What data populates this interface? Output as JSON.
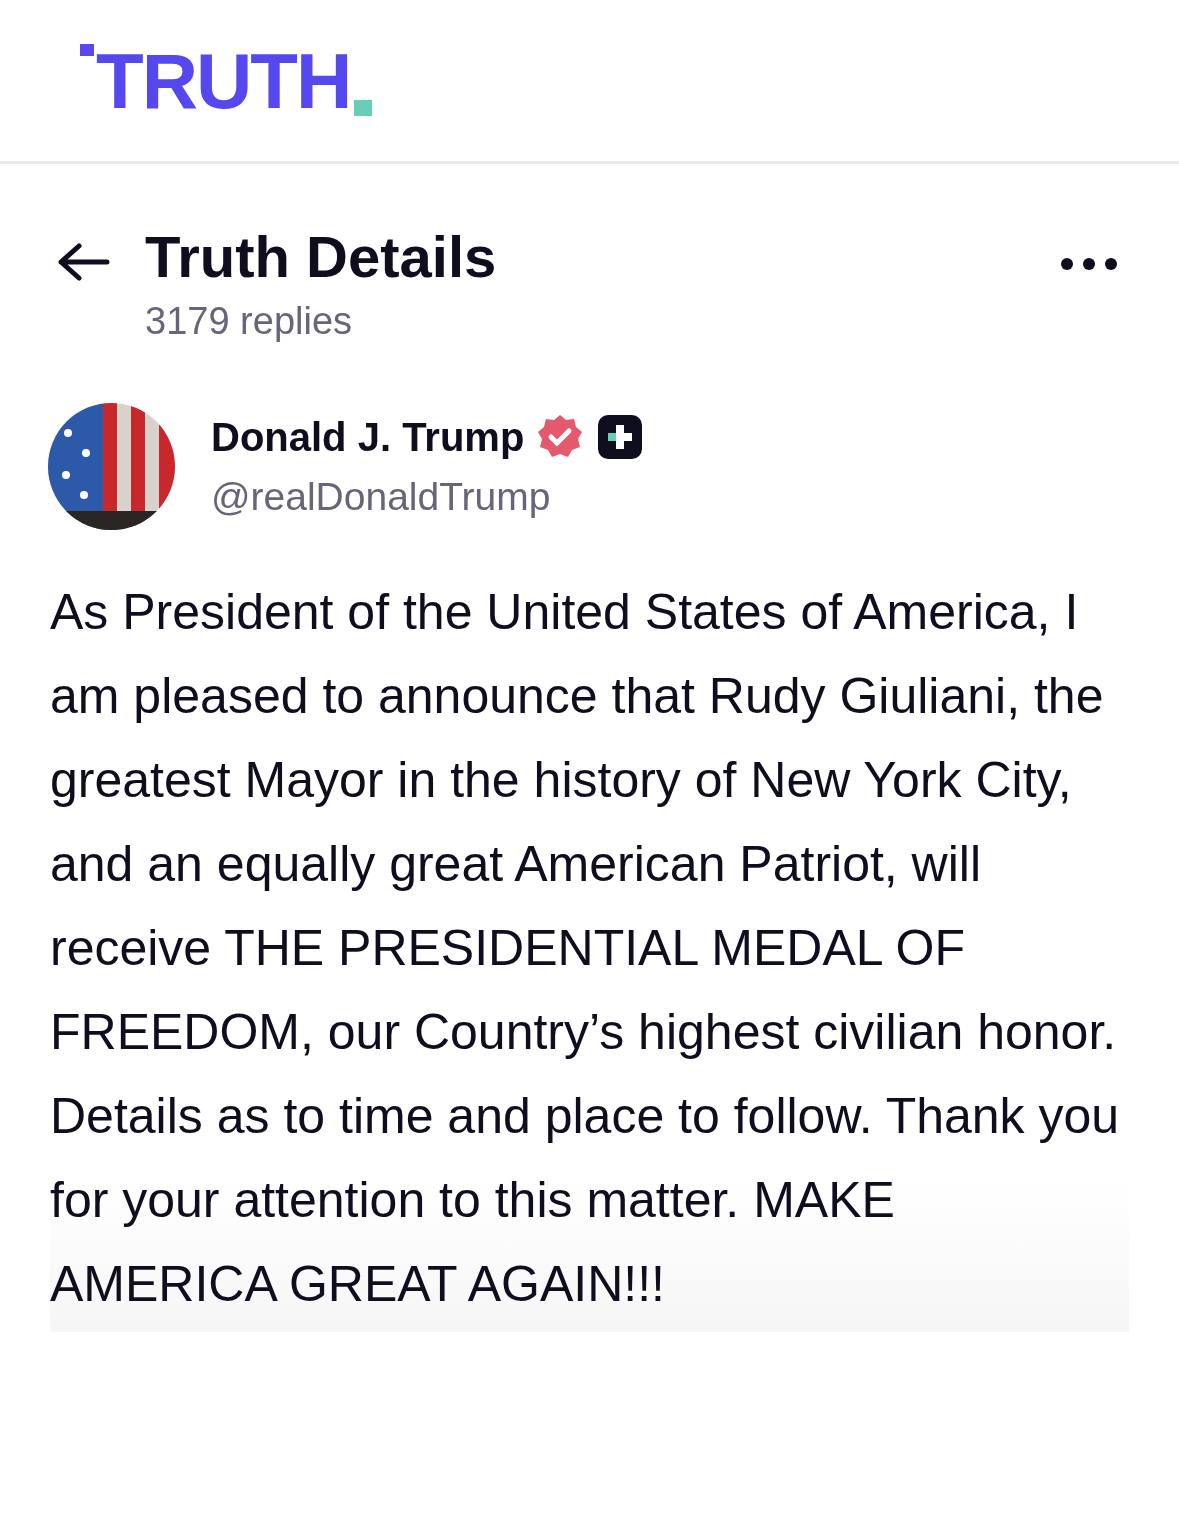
{
  "logo": {
    "text": "TRUTH"
  },
  "header": {
    "title": "Truth Details",
    "subtitle": "3179 replies"
  },
  "post": {
    "author": {
      "name": "Donald J. Trump",
      "handle": "@realDonaldTrump",
      "verified": true,
      "plus": true
    },
    "text": "As President of the United States of America, I am pleased to announce that Rudy Giuliani, the greatest Mayor in the history of New York City, and an equally great American Patriot, will receive THE PRESIDENTIAL MEDAL OF FREEDOM, our Country’s highest civilian honor. Details as to time and place to follow. Thank you for your attention to this matter.  MAKE AMERICA GREAT AGAIN!!!"
  }
}
